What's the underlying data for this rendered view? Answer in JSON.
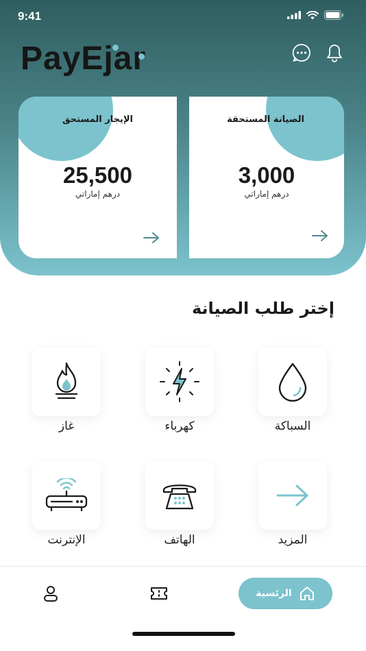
{
  "status_bar": {
    "time": "9:41"
  },
  "header": {
    "logo": "PayEjar"
  },
  "cards": [
    {
      "title": "الصيانة المستحقة",
      "amount": "3,000",
      "currency": "درهم إماراتي"
    },
    {
      "title": "الإيجار المستحق",
      "amount": "25,500",
      "currency": "درهم إماراتي"
    }
  ],
  "section": {
    "title": "إختر طلب الصيانة"
  },
  "services": [
    {
      "label": "السباكة",
      "icon": "water-drop-icon"
    },
    {
      "label": "كهرباء",
      "icon": "lightning-icon"
    },
    {
      "label": "غاز",
      "icon": "gas-flame-icon"
    },
    {
      "label": "المزيد",
      "icon": "arrow-right-icon"
    },
    {
      "label": "الهاتف",
      "icon": "telephone-icon"
    },
    {
      "label": "الإنترنت",
      "icon": "router-icon"
    }
  ],
  "bottom_nav": {
    "home_label": "الرئسية"
  },
  "colors": {
    "accent": "#7cc3cd",
    "dark": "#2f5e60"
  }
}
